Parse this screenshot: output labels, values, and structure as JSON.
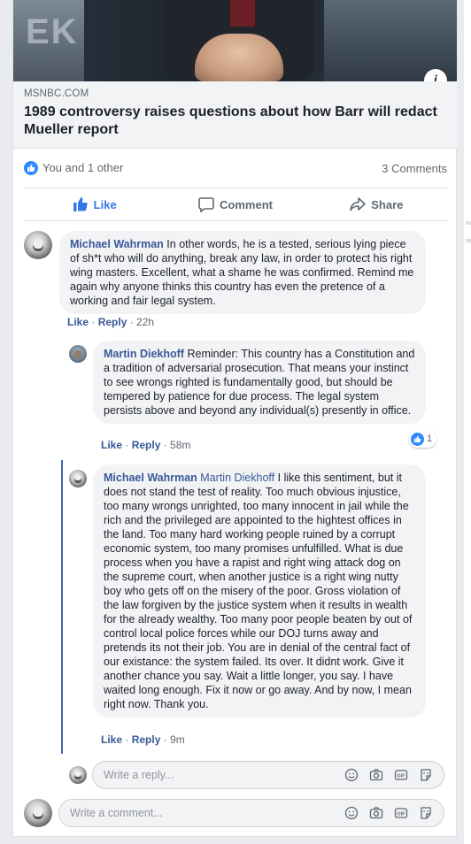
{
  "preview": {
    "domain": "MSNBC.COM",
    "headline": "1989 controversy raises questions about how Barr will redact Mueller report",
    "backdrop_text": "EK"
  },
  "reactions": {
    "summary": "You and 1 other",
    "comments_count": "3 Comments"
  },
  "actions": [
    {
      "label": "Like",
      "icon": "thumbs-up-icon",
      "active": true
    },
    {
      "label": "Comment",
      "icon": "speech-bubble-icon"
    },
    {
      "label": "Share",
      "icon": "share-arrow-icon"
    }
  ],
  "comments": [
    {
      "author": "Michael Wahrman",
      "text": "In other words, he is a tested, serious lying piece of sh*t who will do anything, break any law, in order to protect his right wing masters. Excellent, what a shame he was confirmed. Remind me again why anyone thinks this country has even the pretence of a working and fair legal system.",
      "like": "Like",
      "reply": "Reply",
      "time": "22h"
    },
    {
      "author": "Martin Diekhoff",
      "text": "Reminder: This country has a Constitution and a tradition of adversarial prosecution. That means your instinct to see wrongs righted is fundamentally good, but should be tempered by patience for due process. The legal system persists above and beyond any individual(s) presently in office.",
      "like": "Like",
      "reply": "Reply",
      "time": "58m",
      "reaction_count": "1"
    },
    {
      "author": "Michael Wahrman",
      "mention": "Martin Diekhoff",
      "text": "I like this sentiment, but it does not stand the test of reality. Too much obvious injustice, too many wrongs unrighted, too many innocent in jail while the rich and the privileged are appointed to the hightest offices in the land. Too many hard working people ruined by a corrupt economic system, too many promises unfulfilled. What is due process when you have a rapist and right wing attack dog on the supreme court, when another justice is a right wing nutty boy who gets off on the misery of the poor. Gross violation of the law forgiven by the justice system when it results in wealth for the already wealthy. Too many poor people beaten by out of control local police forces while our DOJ turns away and pretends its not their job. You are in denial of the central fact of our existance: the system failed. Its over. It didnt work. Give it another chance you say. Wait a little longer, you say. I have waited long enough. Fix it now or go away. And by now, I mean right now. Thank you.",
      "like": "Like",
      "reply": "Reply",
      "time": "9m"
    }
  ],
  "reply_input": {
    "placeholder": "Write a reply..."
  },
  "comment_input": {
    "placeholder": "Write a comment..."
  },
  "input_tools": [
    "smiley-icon",
    "camera-icon",
    "gif-icon",
    "sticker-icon"
  ],
  "colors": {
    "link": "#385898",
    "like_blue": "#3578e5",
    "bubble": "#f2f3f5"
  }
}
